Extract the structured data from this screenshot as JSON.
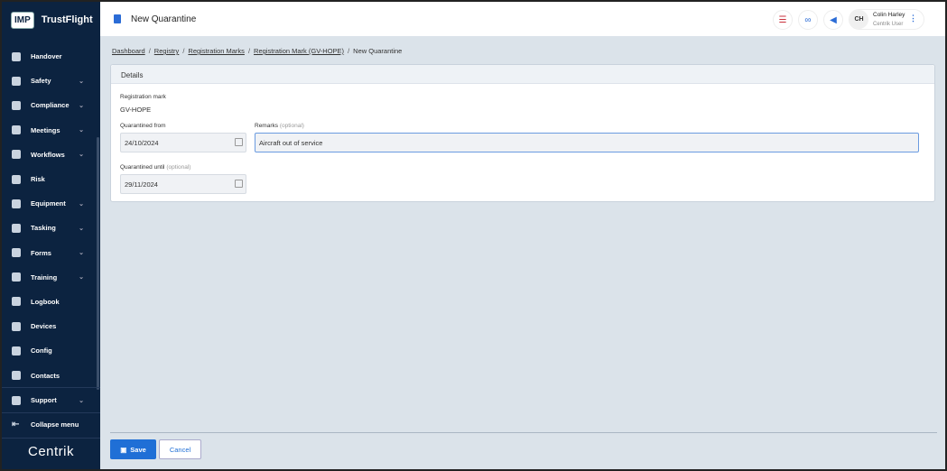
{
  "app": {
    "logo": "IMP",
    "name": "TrustFlight",
    "footer_logo": "Centrik"
  },
  "sidebar": {
    "items": [
      {
        "label": "Handover",
        "chev": false
      },
      {
        "label": "Safety",
        "chev": true
      },
      {
        "label": "Compliance",
        "chev": true
      },
      {
        "label": "Meetings",
        "chev": true
      },
      {
        "label": "Workflows",
        "chev": true
      },
      {
        "label": "Risk",
        "chev": false
      },
      {
        "label": "Equipment",
        "chev": true
      },
      {
        "label": "Tasking",
        "chev": true
      },
      {
        "label": "Forms",
        "chev": true
      },
      {
        "label": "Training",
        "chev": true
      },
      {
        "label": "Logbook",
        "chev": false
      },
      {
        "label": "Devices",
        "chev": false
      },
      {
        "label": "Config",
        "chev": false
      },
      {
        "label": "Contacts",
        "chev": false
      }
    ],
    "support": "Support",
    "collapse": "Collapse menu"
  },
  "header": {
    "title": "New Quarantine",
    "user": {
      "initials": "CH",
      "name": "Colin Harley",
      "role": "Centrik User"
    }
  },
  "breadcrumbs": [
    "Dashboard",
    "Registry",
    "Registration Marks",
    "Registration Mark (GV-HOPE)"
  ],
  "breadcrumb_current": "New Quarantine",
  "form": {
    "section": "Details",
    "reg_label": "Registration mark",
    "reg_value": "GV-HOPE",
    "from_label": "Quarantined from",
    "from_value": "24/10/2024",
    "remarks_label": "Remarks",
    "optional": "(optional)",
    "remarks_value": "Aircraft out of service",
    "until_label": "Quarantined until",
    "until_value": "29/11/2024"
  },
  "actions": {
    "save": "Save",
    "cancel": "Cancel"
  }
}
